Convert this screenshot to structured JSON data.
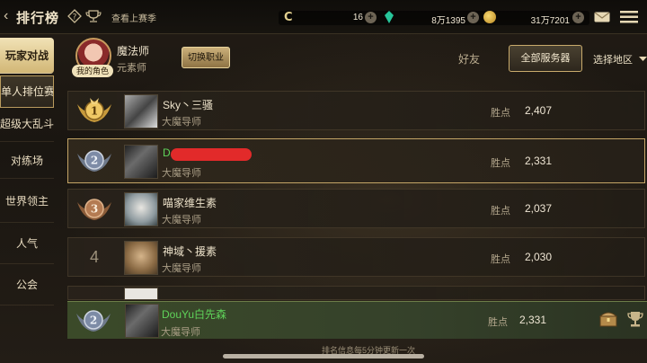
{
  "header": {
    "title": "排行榜",
    "last_season": "查看上赛季",
    "currencies": [
      {
        "icon": "c-coin-icon",
        "value": "16"
      },
      {
        "icon": "gem-icon",
        "value": "8万1395"
      },
      {
        "icon": "gold-coin-icon",
        "value": "31万7201"
      }
    ]
  },
  "sidebar": {
    "category": "玩家对战",
    "items": [
      "单人排位赛",
      "超级大乱斗",
      "对练场",
      "世界领主",
      "人气",
      "公会"
    ]
  },
  "profile": {
    "name": "魔法师",
    "spec": "元素师",
    "my_role_label": "我的角色",
    "switch_label": "切换职业"
  },
  "tabs": {
    "friends": "好友",
    "all_servers": "全部服务器",
    "region": "选择地区"
  },
  "score_label": "胜点",
  "rows": [
    {
      "rank": "1",
      "name": "Sky丶三骚",
      "class": "大魔导师",
      "score": "2,407"
    },
    {
      "rank": "2",
      "name": "D",
      "class": "大魔导师",
      "score": "2,331"
    },
    {
      "rank": "3",
      "name": "喵家维生素",
      "class": "大魔导师",
      "score": "2,037"
    },
    {
      "rank": "4",
      "name": "神域丶援素",
      "class": "大魔导师",
      "score": "2,030"
    }
  ],
  "my_rank": {
    "rank": "2",
    "name": "DouYu白先森",
    "class": "大魔导师",
    "score": "2,331"
  },
  "footer_note": "排名信息每5分钟更新一次",
  "colors": {
    "accent_gold": "#c9ab6c",
    "highlight_green": "#5fd35a",
    "self_row_bg": "#3b4a29"
  }
}
